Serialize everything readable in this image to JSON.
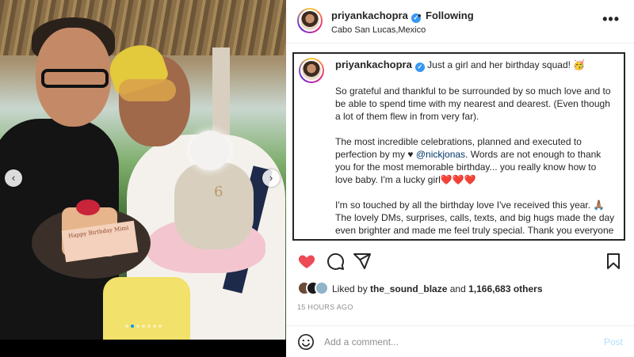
{
  "post": {
    "carousel": {
      "slide_count": 7,
      "active_index": 1,
      "cake_note": "Happy Birthday Mimi",
      "baby_number": "6"
    },
    "header": {
      "username": "priyankachopra",
      "verified_icon": "verified-badge-icon",
      "separator": "•",
      "follow_status": "Following",
      "location": "Cabo San Lucas,Mexico"
    },
    "caption": {
      "username": "priyankachopra",
      "first_line": "Just a girl and her birthday squad! 🥳",
      "paragraph_1": "So grateful and thankful to be surrounded by so much love and to be able to spend time with my nearest and dearest. (Even though a lot of them flew in from very far).",
      "paragraph_2_before": "The most incredible celebrations, planned and executed to perfection by my ♥ ",
      "mention": "@nickjonas",
      "paragraph_2_after": ". Words are not enough to thank you for the most memorable birthday... you really know how to love baby. I'm a lucky girl❤️❤️❤️",
      "paragraph_3": "I'm so touched by all the birthday love I've received this year. 🙏🏽 The lovely DMs, surprises, calls, texts, and big hugs made the day even brighter and made me feel truly special. Thank you everyone who reached out, it means the world."
    },
    "actions": {
      "like_icon": "heart-filled-icon",
      "comment_icon": "comment-icon",
      "share_icon": "share-icon",
      "save_icon": "bookmark-icon",
      "like_color": "#ed4956"
    },
    "likes": {
      "prefix": "Liked by",
      "user": "the_sound_blaze",
      "and": "and",
      "count": "1,166,683 others"
    },
    "timestamp": "15 HOURS AGO",
    "comment_box": {
      "placeholder": "Add a comment...",
      "post_label": "Post",
      "emoji_icon": "smiley-icon"
    }
  }
}
